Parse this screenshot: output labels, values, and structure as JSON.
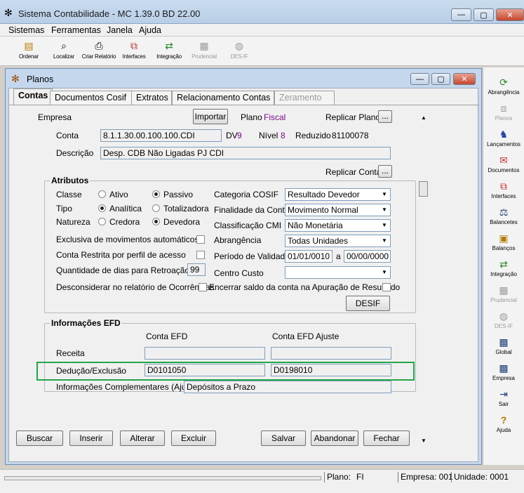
{
  "app": {
    "title": "Sistema Contabilidade  -  MC 1.39.0 BD 22.00",
    "menu": [
      "Sistemas",
      "Ferramentas",
      "Janela",
      "Ajuda"
    ]
  },
  "toolbar": [
    {
      "label": "Ordenar",
      "icon": "sort-icon"
    },
    {
      "label": "Localizar",
      "icon": "find-icon"
    },
    {
      "label": "Criar Relatório",
      "icon": "printer-icon"
    },
    {
      "label": "Interfaces",
      "icon": "interfaces-icon"
    },
    {
      "label": "Integração",
      "icon": "integration-icon"
    },
    {
      "label": "Prudencial",
      "icon": "prudencial-icon"
    },
    {
      "label": "DES-IF",
      "icon": "bag-icon"
    }
  ],
  "rightpanel": [
    {
      "label": "Abrangência",
      "icon": "refresh-icon"
    },
    {
      "label": "Planos",
      "icon": "tree-icon"
    },
    {
      "label": "Lançamentos",
      "icon": "runner-icon"
    },
    {
      "label": "Documentos",
      "icon": "documents-icon"
    },
    {
      "label": "Interfaces",
      "icon": "interfaces-icon"
    },
    {
      "label": "Balancetes",
      "icon": "balance-icon"
    },
    {
      "label": "Balanços",
      "icon": "balance-sheet-icon"
    },
    {
      "label": "Integração",
      "icon": "integration-icon"
    },
    {
      "label": "Prudencial",
      "icon": "prudencial-icon"
    },
    {
      "label": "DES-IF",
      "icon": "bag-icon"
    },
    {
      "label": "Global",
      "icon": "grid-icon"
    },
    {
      "label": "Empresa",
      "icon": "grid-icon"
    },
    {
      "label": "Sair",
      "icon": "exit-icon"
    },
    {
      "label": "Ajuda",
      "icon": "help-icon"
    }
  ],
  "planos": {
    "title": "Planos",
    "tabs": [
      "Contas",
      "Documentos Cosif",
      "Extratos",
      "Relacionamento Contas",
      "Zeramento"
    ],
    "empresa_label": "Empresa",
    "importar": "Importar",
    "plano_label": "Plano",
    "plano_value": "Fiscal",
    "replicar_plano": "Replicar Plano",
    "ellipsis": "...",
    "conta_label": "Conta",
    "conta_value": "8.1.1.30.00.100.100.CDI",
    "dv_label": "DV",
    "dv_value": "9",
    "nivel_label": "Nível",
    "nivel_value": "8",
    "reduzido_label": "Reduzido",
    "reduzido_value": "81100078",
    "descricao_label": "Descrição",
    "descricao_value": "Desp. CDB Não Ligadas PJ CDI",
    "replicar_conta": "Replicar Conta"
  },
  "atributos": {
    "title": "Atributos",
    "classe_label": "Classe",
    "classe_options": [
      "Ativo",
      "Passivo"
    ],
    "tipo_label": "Tipo",
    "tipo_options": [
      "Analítica",
      "Totalizadora"
    ],
    "natureza_label": "Natureza",
    "natureza_options": [
      "Credora",
      "Devedora"
    ],
    "exclusiva": "Exclusiva de movimentos automáticos",
    "restrita": "Conta Restrita por perfil de acesso",
    "retroacao": "Quantidade de dias para Retroação",
    "retroacao_value": "99",
    "desconsiderar": "Desconsiderar no relatório de Ocorrências",
    "encerrar": "Encerrar saldo da conta na Apuração de Resultado",
    "categoria_label": "Categoria COSIF",
    "categoria_value": "Resultado Devedor",
    "finalidade_label": "Finalidade da Conta",
    "finalidade_value": "Movimento Normal",
    "classificacao_label": "Classificação CMI",
    "classificacao_value": "Não Monetária",
    "abrangencia_label": "Abrangência",
    "abrangencia_value": "Todas Unidades",
    "validade_label": "Período de Validade",
    "validade_from": "01/01/0010",
    "validade_a": "a",
    "validade_to": "00/00/0000",
    "centro_label": "Centro Custo",
    "desif": "DESIF"
  },
  "efd": {
    "title": "Informações EFD",
    "col_conta": "Conta EFD",
    "col_ajuste": "Conta EFD Ajuste",
    "receita_label": "Receita",
    "deducao_label": "Dedução/Exclusão",
    "deducao_conta": "D0101050",
    "deducao_ajuste": "D0198010",
    "complementares_label": "Informações Complementares (Ajuste)",
    "complementares_value": "Depósitos a Prazo"
  },
  "buttons": [
    "Buscar",
    "Inserir",
    "Alterar",
    "Excluir",
    "Salvar",
    "Abandonar",
    "Fechar"
  ],
  "status": {
    "plano": "Plano:",
    "plano_value": "FI",
    "empresa": "Empresa: 001",
    "unidade": "Unidade: 0001"
  }
}
